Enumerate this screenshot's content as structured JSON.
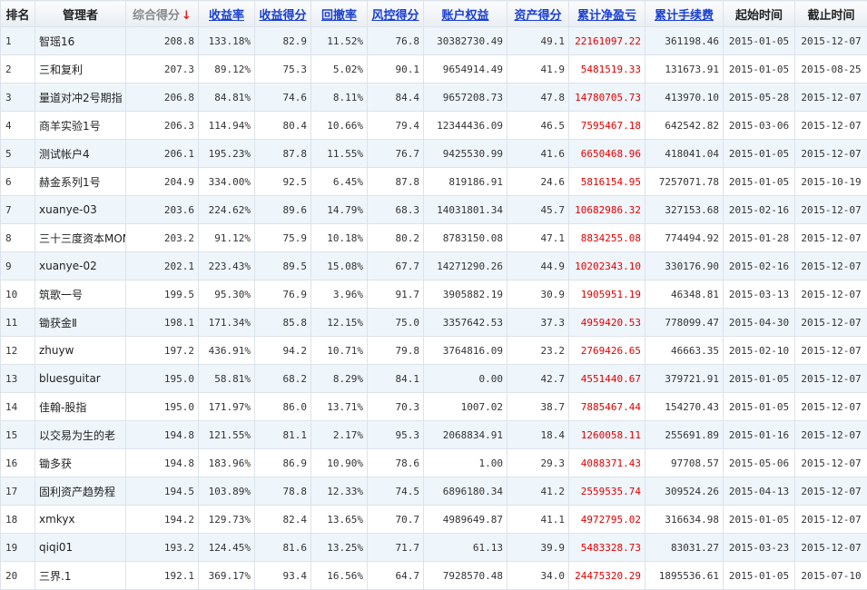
{
  "headers": {
    "rank": "排名",
    "manager": "管理者",
    "composite": "综合得分",
    "sort_arrow": "↓",
    "return_rate": "收益率",
    "return_score": "收益得分",
    "drawdown": "回撤率",
    "risk_score": "风控得分",
    "equity": "账户权益",
    "asset_score": "资产得分",
    "net_profit": "累计净盈亏",
    "fees": "累计手续费",
    "start": "起始时间",
    "end": "截止时间"
  },
  "colors": {
    "profit_text": "#e00000",
    "link_header": "#1a3fd1",
    "row_alt": "#eef5fb"
  },
  "rows": [
    {
      "rank": "1",
      "name": "智瑶16",
      "composite": "208.8",
      "return_rate": "133.18%",
      "return_score": "82.9",
      "drawdown": "11.52%",
      "risk_score": "76.8",
      "equity": "30382730.49",
      "asset_score": "49.1",
      "net_profit": "22161097.22",
      "fees": "361198.46",
      "start": "2015-01-05",
      "end": "2015-12-07"
    },
    {
      "rank": "2",
      "name": "三和复利",
      "composite": "207.3",
      "return_rate": "89.12%",
      "return_score": "75.3",
      "drawdown": "5.02%",
      "risk_score": "90.1",
      "equity": "9654914.49",
      "asset_score": "41.9",
      "net_profit": "5481519.33",
      "fees": "131673.91",
      "start": "2015-01-05",
      "end": "2015-08-25"
    },
    {
      "rank": "3",
      "name": "量道对冲2号期指",
      "composite": "206.8",
      "return_rate": "84.81%",
      "return_score": "74.6",
      "drawdown": "8.11%",
      "risk_score": "84.4",
      "equity": "9657208.73",
      "asset_score": "47.8",
      "net_profit": "14780705.73",
      "fees": "413970.10",
      "start": "2015-05-28",
      "end": "2015-12-07"
    },
    {
      "rank": "4",
      "name": "商羊实验1号",
      "composite": "206.3",
      "return_rate": "114.94%",
      "return_score": "80.4",
      "drawdown": "10.66%",
      "risk_score": "79.4",
      "equity": "12344436.09",
      "asset_score": "46.5",
      "net_profit": "7595467.18",
      "fees": "642542.82",
      "start": "2015-03-06",
      "end": "2015-12-07"
    },
    {
      "rank": "5",
      "name": "测试帐户4",
      "composite": "206.1",
      "return_rate": "195.23%",
      "return_score": "87.8",
      "drawdown": "11.55%",
      "risk_score": "76.7",
      "equity": "9425530.99",
      "asset_score": "41.6",
      "net_profit": "6650468.96",
      "fees": "418041.04",
      "start": "2015-01-05",
      "end": "2015-12-07"
    },
    {
      "rank": "6",
      "name": "赫金系列1号",
      "composite": "204.9",
      "return_rate": "334.00%",
      "return_score": "92.5",
      "drawdown": "6.45%",
      "risk_score": "87.8",
      "equity": "819186.91",
      "asset_score": "24.6",
      "net_profit": "5816154.95",
      "fees": "7257071.78",
      "start": "2015-01-05",
      "end": "2015-10-19"
    },
    {
      "rank": "7",
      "name": "xuanye-03",
      "composite": "203.6",
      "return_rate": "224.62%",
      "return_score": "89.6",
      "drawdown": "14.79%",
      "risk_score": "68.3",
      "equity": "14031801.34",
      "asset_score": "45.7",
      "net_profit": "10682986.32",
      "fees": "327153.68",
      "start": "2015-02-16",
      "end": "2015-12-07"
    },
    {
      "rank": "8",
      "name": "三十三度资本MOM",
      "composite": "203.2",
      "return_rate": "91.12%",
      "return_score": "75.9",
      "drawdown": "10.18%",
      "risk_score": "80.2",
      "equity": "8783150.08",
      "asset_score": "47.1",
      "net_profit": "8834255.08",
      "fees": "774494.92",
      "start": "2015-01-28",
      "end": "2015-12-07"
    },
    {
      "rank": "9",
      "name": "xuanye-02",
      "composite": "202.1",
      "return_rate": "223.43%",
      "return_score": "89.5",
      "drawdown": "15.08%",
      "risk_score": "67.7",
      "equity": "14271290.26",
      "asset_score": "44.9",
      "net_profit": "10202343.10",
      "fees": "330176.90",
      "start": "2015-02-16",
      "end": "2015-12-07"
    },
    {
      "rank": "10",
      "name": "筑歌一号",
      "composite": "199.5",
      "return_rate": "95.30%",
      "return_score": "76.9",
      "drawdown": "3.96%",
      "risk_score": "91.7",
      "equity": "3905882.19",
      "asset_score": "30.9",
      "net_profit": "1905951.19",
      "fees": "46348.81",
      "start": "2015-03-13",
      "end": "2015-12-07"
    },
    {
      "rank": "11",
      "name": "锄获金Ⅱ",
      "composite": "198.1",
      "return_rate": "171.34%",
      "return_score": "85.8",
      "drawdown": "12.15%",
      "risk_score": "75.0",
      "equity": "3357642.53",
      "asset_score": "37.3",
      "net_profit": "4959420.53",
      "fees": "778099.47",
      "start": "2015-04-30",
      "end": "2015-12-07"
    },
    {
      "rank": "12",
      "name": "zhuyw",
      "composite": "197.2",
      "return_rate": "436.91%",
      "return_score": "94.2",
      "drawdown": "10.71%",
      "risk_score": "79.8",
      "equity": "3764816.09",
      "asset_score": "23.2",
      "net_profit": "2769426.65",
      "fees": "46663.35",
      "start": "2015-02-10",
      "end": "2015-12-07"
    },
    {
      "rank": "13",
      "name": "bluesguitar",
      "composite": "195.0",
      "return_rate": "58.81%",
      "return_score": "68.2",
      "drawdown": "8.29%",
      "risk_score": "84.1",
      "equity": "0.00",
      "asset_score": "42.7",
      "net_profit": "4551440.67",
      "fees": "379721.91",
      "start": "2015-01-05",
      "end": "2015-12-07"
    },
    {
      "rank": "14",
      "name": "佳翰-股指",
      "composite": "195.0",
      "return_rate": "171.97%",
      "return_score": "86.0",
      "drawdown": "13.71%",
      "risk_score": "70.3",
      "equity": "1007.02",
      "asset_score": "38.7",
      "net_profit": "7885467.44",
      "fees": "154270.43",
      "start": "2015-01-05",
      "end": "2015-12-07"
    },
    {
      "rank": "15",
      "name": "以交易为生的老",
      "composite": "194.8",
      "return_rate": "121.55%",
      "return_score": "81.1",
      "drawdown": "2.17%",
      "risk_score": "95.3",
      "equity": "2068834.91",
      "asset_score": "18.4",
      "net_profit": "1260058.11",
      "fees": "255691.89",
      "start": "2015-01-16",
      "end": "2015-12-07"
    },
    {
      "rank": "16",
      "name": "锄多获",
      "composite": "194.8",
      "return_rate": "183.96%",
      "return_score": "86.9",
      "drawdown": "10.90%",
      "risk_score": "78.6",
      "equity": "1.00",
      "asset_score": "29.3",
      "net_profit": "4088371.43",
      "fees": "97708.57",
      "start": "2015-05-06",
      "end": "2015-12-07"
    },
    {
      "rank": "17",
      "name": "固利资产趋势程",
      "composite": "194.5",
      "return_rate": "103.89%",
      "return_score": "78.8",
      "drawdown": "12.33%",
      "risk_score": "74.5",
      "equity": "6896180.34",
      "asset_score": "41.2",
      "net_profit": "2559535.74",
      "fees": "309524.26",
      "start": "2015-04-13",
      "end": "2015-12-07"
    },
    {
      "rank": "18",
      "name": "xmkyx",
      "composite": "194.2",
      "return_rate": "129.73%",
      "return_score": "82.4",
      "drawdown": "13.65%",
      "risk_score": "70.7",
      "equity": "4989649.87",
      "asset_score": "41.1",
      "net_profit": "4972795.02",
      "fees": "316634.98",
      "start": "2015-01-05",
      "end": "2015-12-07"
    },
    {
      "rank": "19",
      "name": "qiqi01",
      "composite": "193.2",
      "return_rate": "124.45%",
      "return_score": "81.6",
      "drawdown": "13.25%",
      "risk_score": "71.7",
      "equity": "61.13",
      "asset_score": "39.9",
      "net_profit": "5483328.73",
      "fees": "83031.27",
      "start": "2015-03-23",
      "end": "2015-12-07"
    },
    {
      "rank": "20",
      "name": "三界.1",
      "composite": "192.1",
      "return_rate": "369.17%",
      "return_score": "93.4",
      "drawdown": "16.56%",
      "risk_score": "64.7",
      "equity": "7928570.48",
      "asset_score": "34.0",
      "net_profit": "24475320.29",
      "fees": "1895536.61",
      "start": "2015-01-05",
      "end": "2015-07-10"
    }
  ]
}
